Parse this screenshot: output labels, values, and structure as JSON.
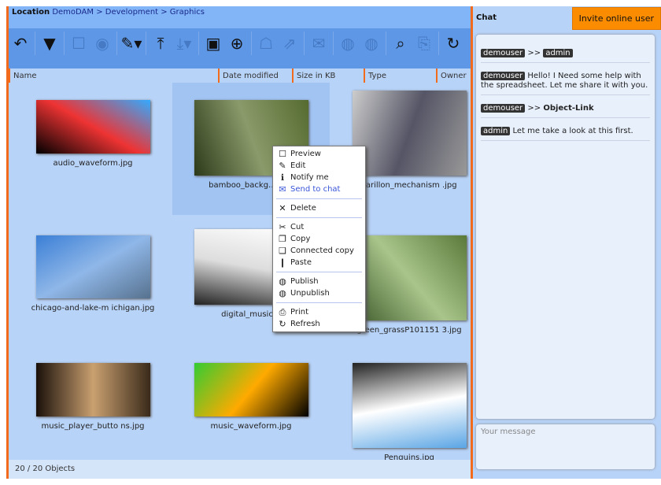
{
  "location": {
    "label": "Location",
    "path": "DemoDAM > Development > Graphics"
  },
  "toolbar": [
    "back-icon",
    "filter-icon",
    "preview-icon",
    "view-icon",
    "edit-icon",
    "upload-icon",
    "download-icon",
    "new-folder-icon",
    "new-file-icon",
    "publish-icon",
    "share-icon",
    "mail-icon",
    "globe-publish-icon",
    "globe-unpublish-icon",
    "search-icon",
    "export-icon",
    "refresh-icon"
  ],
  "columns": [
    "Name",
    "Date modified",
    "Size in KB",
    "Type",
    "Owner"
  ],
  "items": [
    {
      "name": "audio_waveform.jpg",
      "colors": [
        "#000",
        "#e33",
        "#3af"
      ]
    },
    {
      "name": "bamboo_backg… .jpg",
      "colors": [
        "#2d3a1a",
        "#8a9a6a",
        "#556b2f"
      ]
    },
    {
      "name": "carillon_mechanism .jpg",
      "colors": [
        "#ccc",
        "#556",
        "#999"
      ]
    },
    {
      "name": "chicago-and-lake-m ichigan.jpg",
      "colors": [
        "#3b7fd6",
        "#8fb7e8",
        "#57728f"
      ]
    },
    {
      "name": "digital_music…",
      "colors": [
        "#fff",
        "#ddd",
        "#222"
      ]
    },
    {
      "name": "green_grassP101151 3.jpg",
      "colors": [
        "#5a7a3a",
        "#a9c58b",
        "#3d5a2a"
      ]
    },
    {
      "name": "music_player_butto ns.jpg",
      "colors": [
        "#3a2a1a",
        "#c9a070",
        "#1a100a"
      ]
    },
    {
      "name": "music_waveform.jpg",
      "colors": [
        "#000",
        "#fa0",
        "#3c3"
      ]
    },
    {
      "name": "Penguins.jpg",
      "colors": [
        "#5aa5e5",
        "#fff",
        "#222"
      ]
    }
  ],
  "context_menu": {
    "groups": [
      [
        {
          "label": "Preview",
          "icon": "☐"
        },
        {
          "label": "Edit",
          "icon": "✎"
        },
        {
          "label": "Notify me",
          "icon": "ℹ"
        },
        {
          "label": "Send to chat",
          "icon": "✉",
          "highlight": true
        }
      ],
      [
        {
          "label": "Delete",
          "icon": "✕"
        }
      ],
      [
        {
          "label": "Cut",
          "icon": "✂"
        },
        {
          "label": "Copy",
          "icon": "❐"
        },
        {
          "label": "Connected copy",
          "icon": "❑"
        },
        {
          "label": "Paste",
          "icon": "❙"
        }
      ],
      [
        {
          "label": "Publish",
          "icon": "◍"
        },
        {
          "label": "Unpublish",
          "icon": "◍"
        }
      ],
      [
        {
          "label": "Print",
          "icon": "⎙"
        },
        {
          "label": "Refresh",
          "icon": "↻"
        }
      ]
    ]
  },
  "status": "20 / 20 Objects",
  "chat": {
    "title": "Chat",
    "invite": "Invite online user",
    "messages": [
      {
        "user": "demouser",
        "text": ">>",
        "to": "admin"
      },
      {
        "user": "demouser",
        "text": "Hello! I Need some help with the spreadsheet. Let me share it with you."
      },
      {
        "user": "demouser",
        "text": ">>",
        "bold": "Object-Link"
      },
      {
        "user": "admin",
        "text": "Let me take a look at this first."
      }
    ],
    "placeholder": "Your message"
  },
  "colors": {
    "accent": "#f26a1b",
    "invite": "#fb8c00",
    "toolbar": "#5d97e6"
  }
}
